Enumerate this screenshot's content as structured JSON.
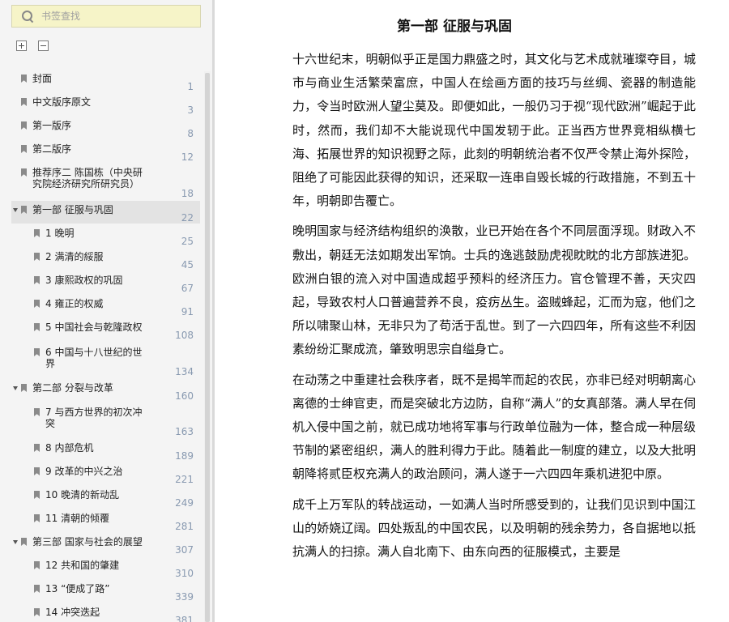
{
  "search": {
    "placeholder": "书签查找"
  },
  "tools": {
    "expand_all_icon": "expand-all-icon",
    "collapse_all_icon": "collapse-all-icon"
  },
  "toc": [
    {
      "label": "封面",
      "page": "1",
      "level": 0
    },
    {
      "label": "中文版序原文",
      "page": "3",
      "level": 0
    },
    {
      "label": "第一版序",
      "page": "8",
      "level": 0
    },
    {
      "label": "第二版序",
      "page": "12",
      "level": 0
    },
    {
      "label": "推荐序二 陈国栋（中央研",
      "label2": "究院经济研究所研究员）",
      "page": "18",
      "level": 0
    },
    {
      "label": "第一部 征服与巩固",
      "page": "22",
      "level": 0,
      "expanded": true,
      "selected": true
    },
    {
      "label": "1 晚明",
      "page": "25",
      "level": 1
    },
    {
      "label": "2 满清的綏服",
      "page": "45",
      "level": 1
    },
    {
      "label": "3 康熙政权的巩固",
      "page": "67",
      "level": 1
    },
    {
      "label": "4 雍正的权威",
      "page": "91",
      "level": 1
    },
    {
      "label": "5 中国社会与乾隆政权",
      "page": "108",
      "level": 1
    },
    {
      "label": "6 中国与十八世纪的世",
      "label2": "界",
      "page": "134",
      "level": 1
    },
    {
      "label": "第二部 分裂与改革",
      "page": "160",
      "level": 0,
      "expanded": true
    },
    {
      "label": "7 与西方世界的初次冲",
      "label2": "突",
      "page": "163",
      "level": 1
    },
    {
      "label": "8 内部危机",
      "page": "189",
      "level": 1
    },
    {
      "label": "9 改革的中兴之治",
      "page": "221",
      "level": 1
    },
    {
      "label": "10 晚清的新动乱",
      "page": "249",
      "level": 1
    },
    {
      "label": "11 清朝的倾覆",
      "page": "281",
      "level": 1
    },
    {
      "label": "第三部 国家与社会的展望",
      "page": "307",
      "level": 0,
      "expanded": true
    },
    {
      "label": "12 共和国的肇建",
      "page": "310",
      "level": 1
    },
    {
      "label": "13 “便成了路”",
      "page": "339",
      "level": 1
    },
    {
      "label": "14 冲突迭起",
      "page": "381",
      "level": 1
    }
  ],
  "content": {
    "title": "第一部 征服与巩固",
    "paragraphs": [
      "十六世纪末，明朝似乎正是国力鼎盛之时，其文化与艺术成就璀璨夺目，城市与商业生活繁荣富庶，中国人在绘画方面的技巧与丝绸、瓷器的制造能力，令当时欧洲人望尘莫及。即便如此，一般仍习于视“现代欧洲”崛起于此时，然而，我们却不大能说现代中国发轫于此。正当西方世界竞相纵横七海、拓展世界的知识视野之际，此刻的明朝统治者不仅严令禁止海外探险，阻绝了可能因此获得的知识，还采取一连串自毁长城的行政措施，不到五十年，明朝即告覆亡。",
      "晚明国家与经济结构组织的涣散，业已开始在各个不同层面浮现。财政入不敷出，朝廷无法如期发出军饷。士兵的逸逃鼓励虎视眈眈的北方部族进犯。欧洲白银的流入对中国造成超乎预料的经济压力。官仓管理不善，天灾四起，导致农村人口普遍营养不良，疫疠丛生。盗贼蜂起，汇而为寇，他们之所以啸聚山林，无非只为了苟活于乱世。到了一六四四年，所有这些不利因素纷纷汇聚成流，肇致明思宗自缢身亡。",
      "在动荡之中重建社会秩序者，既不是揭竿而起的农民，亦非已经对明朝离心离德的士绅官吏，而是突破北方边防，自称“满人”的女真部落。满人早在伺机入侵中国之前，就已成功地将军事与行政单位融为一体，整合成一种层级节制的紧密组织，满人的胜利得力于此。随着此一制度的建立，以及大批明朝降将贰臣权充满人的政治顾问，满人遂于一六四四年乘机进犯中原。",
      "成千上万军队的转战运动，一如满人当时所感受到的，让我们见识到中国江山的娇娆辽阔。四处叛乱的中国农民，以及明朝的残余势力，各自据地以抵抗满人的扫掠。满人自北南下、由东向西的征服模式，主要是"
    ]
  }
}
